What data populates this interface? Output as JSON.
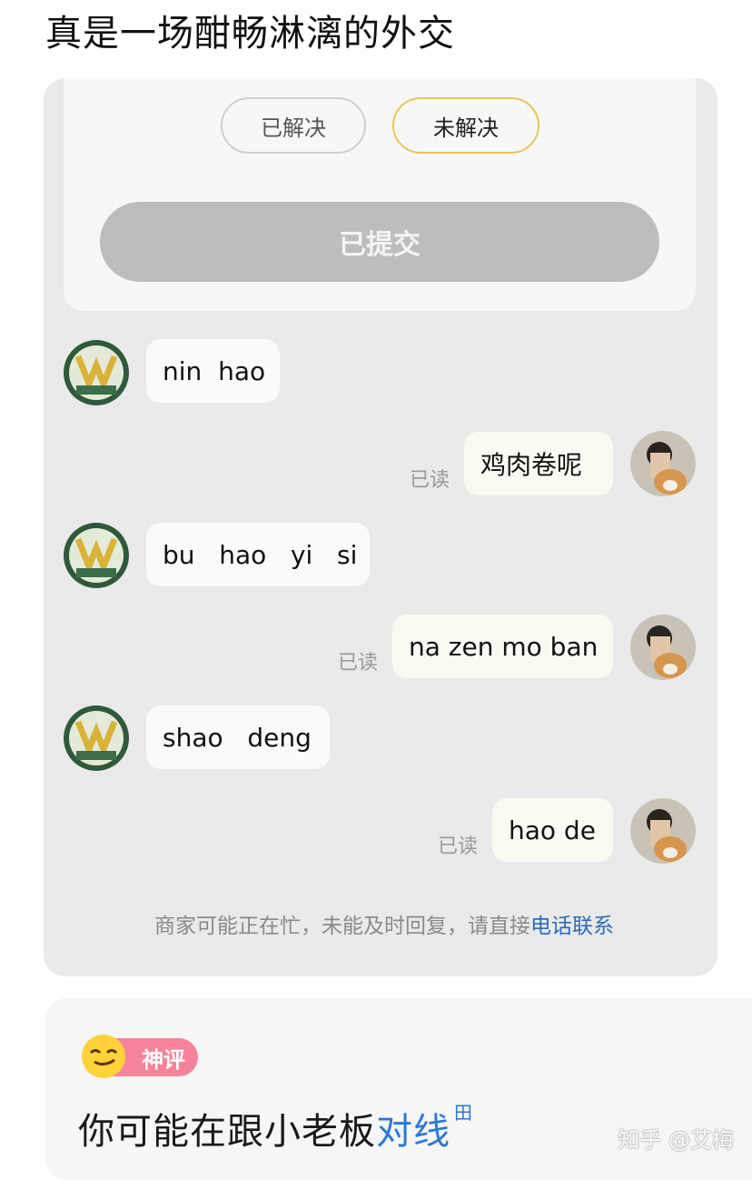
{
  "headline": "真是一场酣畅淋漓的外交",
  "status_pills": {
    "resolved": "已解决",
    "unresolved": "未解决"
  },
  "submit_label": "已提交",
  "messages": [
    {
      "from": "merchant",
      "text": "nin  hao"
    },
    {
      "from": "me",
      "text": "鸡肉卷呢",
      "status": "已读"
    },
    {
      "from": "merchant",
      "text": "bu   hao   yi   si"
    },
    {
      "from": "me",
      "text": "na zen mo ban",
      "status": "已读"
    },
    {
      "from": "merchant",
      "text": "shao   deng"
    },
    {
      "from": "me",
      "text": "hao de",
      "status": "已读"
    }
  ],
  "notice": {
    "text": "商家可能正在忙，未能及时回复，请直接",
    "link": "电话联系"
  },
  "comment": {
    "badge_label": "神评",
    "text_prefix": "你可能在跟小老板",
    "text_highlight": "对线",
    "superscript": "田"
  },
  "watermark": "知乎 @艾梅",
  "colors": {
    "card_bg": "#eaeaea",
    "unresolved_border": "#e6c65a",
    "submit_bg": "#bdbdbd",
    "link": "#2b6cb8",
    "badge_pink": "#f7839a"
  }
}
